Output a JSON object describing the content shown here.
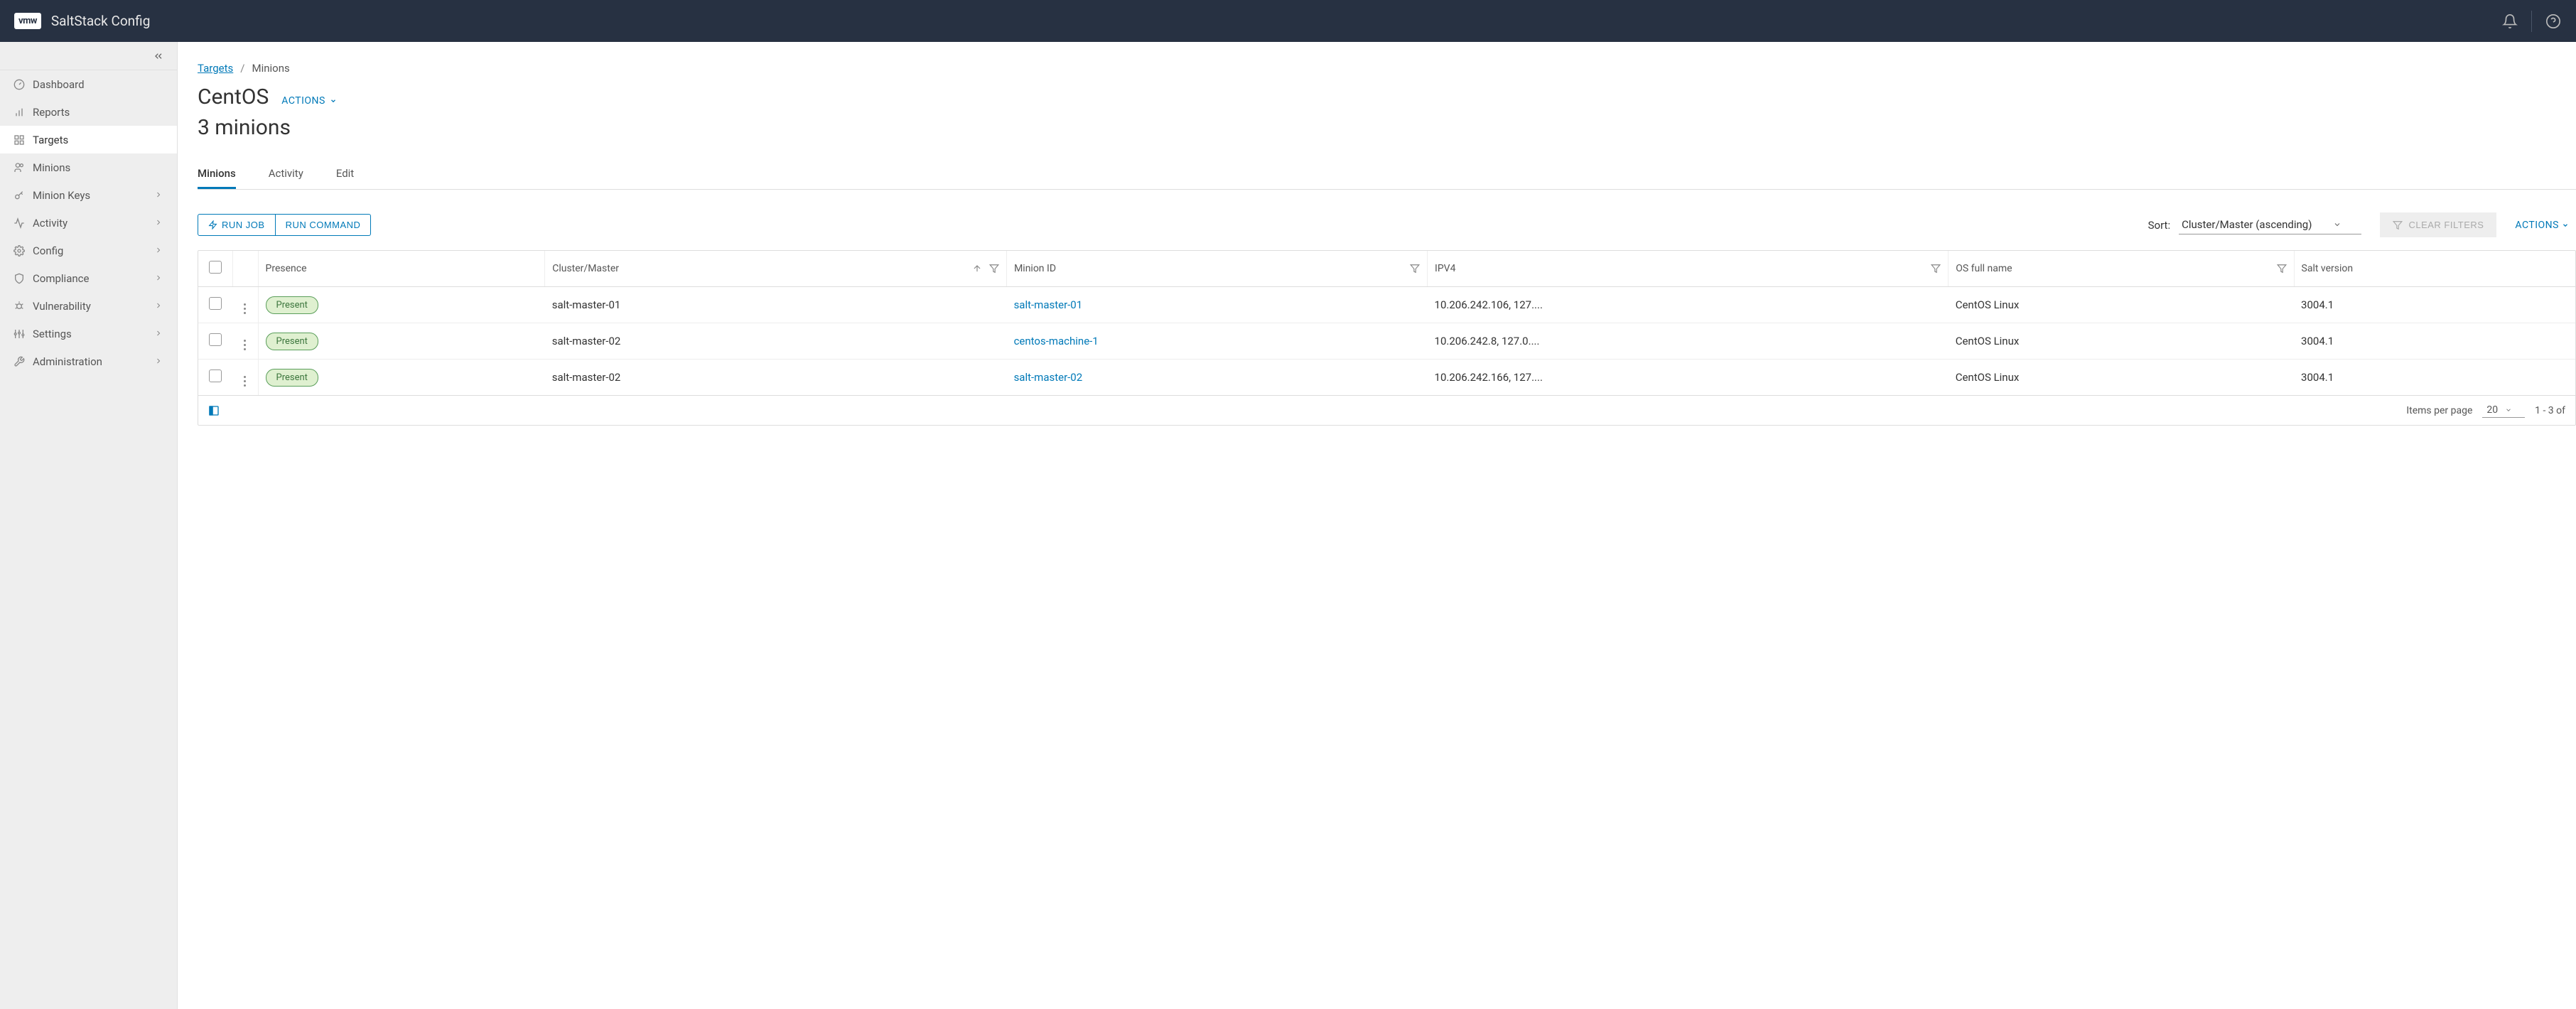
{
  "header": {
    "logo_text": "vmw",
    "app_name": "SaltStack Config"
  },
  "sidebar": {
    "items": [
      {
        "label": "Dashboard",
        "icon": "gauge",
        "expandable": false
      },
      {
        "label": "Reports",
        "icon": "bar-chart",
        "expandable": false
      },
      {
        "label": "Targets",
        "icon": "grid",
        "expandable": false,
        "active": true
      },
      {
        "label": "Minions",
        "icon": "users",
        "expandable": false
      },
      {
        "label": "Minion Keys",
        "icon": "key",
        "expandable": true
      },
      {
        "label": "Activity",
        "icon": "activity",
        "expandable": true
      },
      {
        "label": "Config",
        "icon": "gear",
        "expandable": true
      },
      {
        "label": "Compliance",
        "icon": "shield",
        "expandable": true
      },
      {
        "label": "Vulnerability",
        "icon": "bug",
        "expandable": true
      },
      {
        "label": "Settings",
        "icon": "sliders",
        "expandable": true
      },
      {
        "label": "Administration",
        "icon": "wrench",
        "expandable": true
      }
    ]
  },
  "breadcrumb": {
    "root": "Targets",
    "current": "Minions"
  },
  "page": {
    "title": "CentOS",
    "actions_label": "ACTIONS",
    "subtitle": "3 minions"
  },
  "tabs": [
    {
      "label": "Minions",
      "active": true
    },
    {
      "label": "Activity",
      "active": false
    },
    {
      "label": "Edit",
      "active": false
    }
  ],
  "toolbar": {
    "run_job": "RUN JOB",
    "run_command": "RUN COMMAND",
    "sort_label": "Sort:",
    "sort_value": "Cluster/Master (ascending)",
    "clear_filters": "CLEAR FILTERS",
    "actions_label": "ACTIONS"
  },
  "table": {
    "columns": {
      "presence": "Presence",
      "cluster": "Cluster/Master",
      "minion_id": "Minion ID",
      "ipv4": "IPV4",
      "os": "OS full name",
      "salt": "Salt version"
    },
    "rows": [
      {
        "presence": "Present",
        "cluster": "salt-master-01",
        "minion_id": "salt-master-01",
        "ipv4": "10.206.242.106, 127....",
        "os": "CentOS Linux",
        "salt": "3004.1"
      },
      {
        "presence": "Present",
        "cluster": "salt-master-02",
        "minion_id": "centos-machine-1",
        "ipv4": "10.206.242.8, 127.0....",
        "os": "CentOS Linux",
        "salt": "3004.1"
      },
      {
        "presence": "Present",
        "cluster": "salt-master-02",
        "minion_id": "salt-master-02",
        "ipv4": "10.206.242.166, 127....",
        "os": "CentOS Linux",
        "salt": "3004.1"
      }
    ]
  },
  "footer": {
    "ipp_label": "Items per page",
    "ipp_value": "20",
    "range": "1 - 3 of"
  }
}
